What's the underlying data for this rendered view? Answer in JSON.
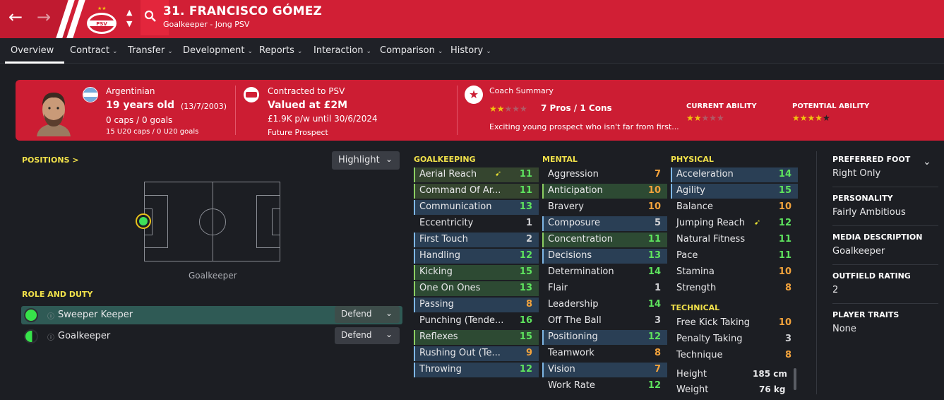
{
  "header": {
    "title": "31. FRANCISCO GÓMEZ",
    "subtitle": "Goalkeeper - Jong PSV",
    "back_icon": "←",
    "forward_icon": "→",
    "club_badge": "PSV"
  },
  "tabs": [
    {
      "label": "Overview"
    },
    {
      "label": "Contract"
    },
    {
      "label": "Transfer"
    },
    {
      "label": "Development"
    },
    {
      "label": "Reports"
    },
    {
      "label": "Interaction"
    },
    {
      "label": "Comparison"
    },
    {
      "label": "History"
    }
  ],
  "card": {
    "nationality": "Argentinian",
    "age": "19 years old",
    "dob": "(13/7/2003)",
    "caps": "0 caps / 0 goals",
    "u20_caps": "15 U20 caps / 0 U20 goals",
    "contract_label": "Contracted to PSV",
    "value": "Valued at £2M",
    "wage": "£1.9K p/w until 30/6/2024",
    "status": "Future Prospect",
    "coach_label": "Coach Summary",
    "coach_pros": "7 Pros / 1 Cons",
    "coach_text": "Exciting young prospect who isn't far from first...",
    "coach_stars": 2,
    "current_ability_label": "CURRENT ABILITY",
    "current_ability_stars": 2.5,
    "potential_ability_label": "POTENTIAL ABILITY",
    "potential_ability_stars": 4.5
  },
  "positions": {
    "label": "POSITIONS >",
    "highlight": "Highlight",
    "position_name": "Goalkeeper"
  },
  "role": {
    "label": "ROLE AND DUTY",
    "roles": [
      {
        "name": "Sweeper Keeper",
        "duty": "Defend"
      },
      {
        "name": "Goalkeeper",
        "duty": "Defend"
      }
    ]
  },
  "goalkeeping": {
    "label": "GOALKEEPING",
    "attrs": [
      {
        "name": "Aerial Reach",
        "value": "11"
      },
      {
        "name": "Command Of Ar...",
        "value": "11"
      },
      {
        "name": "Communication",
        "value": "13"
      },
      {
        "name": "Eccentricity",
        "value": "1"
      },
      {
        "name": "First Touch",
        "value": "2"
      },
      {
        "name": "Handling",
        "value": "12"
      },
      {
        "name": "Kicking",
        "value": "15"
      },
      {
        "name": "One On Ones",
        "value": "13"
      },
      {
        "name": "Passing",
        "value": "8"
      },
      {
        "name": "Punching (Tende...",
        "value": "16"
      },
      {
        "name": "Reflexes",
        "value": "15"
      },
      {
        "name": "Rushing Out (Te...",
        "value": "9"
      },
      {
        "name": "Throwing",
        "value": "12"
      }
    ]
  },
  "mental": {
    "label": "MENTAL",
    "attrs": [
      {
        "name": "Aggression",
        "value": "7"
      },
      {
        "name": "Anticipation",
        "value": "10"
      },
      {
        "name": "Bravery",
        "value": "10"
      },
      {
        "name": "Composure",
        "value": "5"
      },
      {
        "name": "Concentration",
        "value": "11"
      },
      {
        "name": "Decisions",
        "value": "13"
      },
      {
        "name": "Determination",
        "value": "14"
      },
      {
        "name": "Flair",
        "value": "1"
      },
      {
        "name": "Leadership",
        "value": "14"
      },
      {
        "name": "Off The Ball",
        "value": "3"
      },
      {
        "name": "Positioning",
        "value": "12"
      },
      {
        "name": "Teamwork",
        "value": "8"
      },
      {
        "name": "Vision",
        "value": "7"
      },
      {
        "name": "Work Rate",
        "value": "12"
      }
    ]
  },
  "physical": {
    "label": "PHYSICAL",
    "attrs": [
      {
        "name": "Acceleration",
        "value": "14"
      },
      {
        "name": "Agility",
        "value": "15"
      },
      {
        "name": "Balance",
        "value": "10"
      },
      {
        "name": "Jumping Reach",
        "value": "12"
      },
      {
        "name": "Natural Fitness",
        "value": "11"
      },
      {
        "name": "Pace",
        "value": "11"
      },
      {
        "name": "Stamina",
        "value": "10"
      },
      {
        "name": "Strength",
        "value": "8"
      }
    ]
  },
  "technical": {
    "label": "TECHNICAL",
    "attrs": [
      {
        "name": "Free Kick Taking",
        "value": "10"
      },
      {
        "name": "Penalty Taking",
        "value": "3"
      },
      {
        "name": "Technique",
        "value": "8"
      }
    ]
  },
  "measures": {
    "height_label": "Height",
    "height": "185 cm",
    "weight_label": "Weight",
    "weight": "76 kg"
  },
  "right_panel": [
    {
      "label": "PREFERRED FOOT",
      "value": "Right Only"
    },
    {
      "label": "PERSONALITY",
      "value": "Fairly Ambitious"
    },
    {
      "label": "MEDIA DESCRIPTION",
      "value": "Goalkeeper"
    },
    {
      "label": "OUTFIELD RATING",
      "value": "2"
    },
    {
      "label": "PLAYER TRAITS",
      "value": "None"
    }
  ],
  "colors": {
    "header_red": "#d11f35",
    "accent_yellow": "#f1e14a",
    "value_green": "#5ee35e",
    "value_orange": "#f3a33c",
    "value_grey": "#cfd0d3"
  }
}
